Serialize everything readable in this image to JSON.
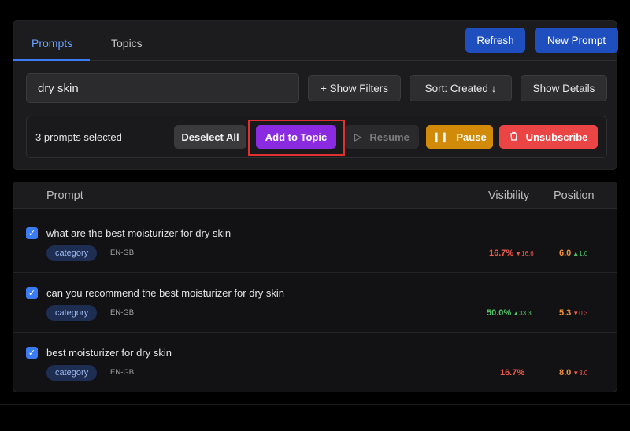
{
  "tabs": [
    {
      "label": "Prompts",
      "active": true
    },
    {
      "label": "Topics",
      "active": false
    }
  ],
  "header_buttons": {
    "refresh": "Refresh",
    "new_prompt": "New Prompt"
  },
  "search": {
    "value": "dry skin"
  },
  "toolbar": {
    "show_filters": "+ Show Filters",
    "sort": "Sort: Created ↓",
    "show_details": "Show Details"
  },
  "selection": {
    "count_text": "3 prompts selected",
    "deselect_all": "Deselect All",
    "add_to_topic": "Add to Topic",
    "resume": "Resume",
    "pause": "Pause",
    "unsubscribe": "Unsubscribe"
  },
  "table": {
    "headers": {
      "prompt": "Prompt",
      "visibility": "Visibility",
      "position": "Position"
    },
    "rows": [
      {
        "text": "what are the best moisturizer for dry skin",
        "category": "category",
        "locale": "EN-GB",
        "visibility": "16.7%",
        "visibility_delta": "▼16.6",
        "position": "6.0",
        "position_delta": "▲1.0",
        "checked": true
      },
      {
        "text": "can you recommend the best moisturizer for dry skin",
        "category": "category",
        "locale": "EN-GB",
        "visibility": "50.0%",
        "visibility_delta": "▲33.3",
        "position": "5.3",
        "position_delta": "▼0.3",
        "checked": true
      },
      {
        "text": "best moisturizer for dry skin",
        "category": "category",
        "locale": "EN-GB",
        "visibility": "16.7%",
        "visibility_delta": "",
        "position": "8.0",
        "position_delta": "▼3.0",
        "checked": true
      }
    ]
  },
  "colors": {
    "accent_blue": "#3b7cf5",
    "add_to_topic_purple": "#8a2be2",
    "pause_amber": "#d28a0a",
    "unsubscribe_red": "#ea4444",
    "positive_green": "#4cc86a",
    "negative_red": "#ef5a4c"
  },
  "icons": {
    "resume": "play-icon",
    "pause": "pause-icon",
    "unsubscribe": "trash-icon",
    "checkbox": "checkmark-icon"
  }
}
